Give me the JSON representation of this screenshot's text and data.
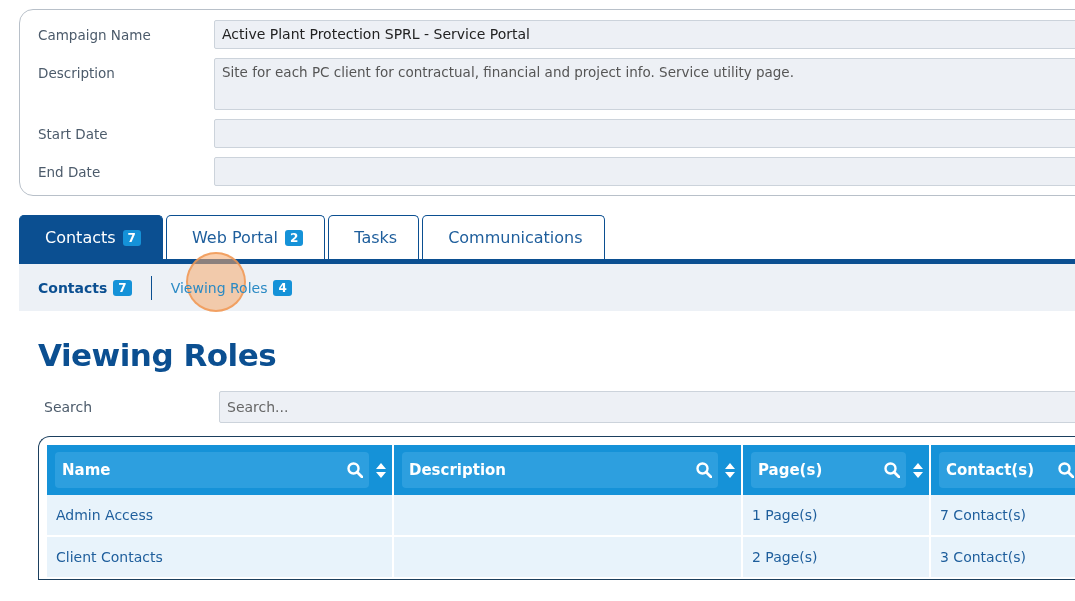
{
  "form": {
    "fields": [
      {
        "label": "Campaign Name",
        "value": "Active Plant Protection SPRL - Service Portal",
        "kind": "text"
      },
      {
        "label": "Description",
        "value": "Site for each PC client for contractual, financial and project info. Service utility page.",
        "kind": "textarea"
      },
      {
        "label": "Start Date",
        "kind": "text"
      },
      {
        "label": "End Date",
        "kind": "text"
      }
    ]
  },
  "tabs": [
    {
      "label": "Contacts",
      "badge": "7",
      "selected": true
    },
    {
      "label": "Web Portal",
      "badge": "2",
      "selected": false
    },
    {
      "label": "Tasks",
      "selected": false
    },
    {
      "label": "Communications",
      "selected": false
    }
  ],
  "subtabs": [
    {
      "label": "Contacts",
      "badge": "7",
      "selected": true,
      "highlighted": false
    },
    {
      "label": "Viewing Roles",
      "badge": "4",
      "selected": false,
      "highlighted": true
    }
  ],
  "heading": "Viewing Roles",
  "search": {
    "label": "Search",
    "placeholder": "Search..."
  },
  "table": {
    "columns": [
      "Name",
      "Description",
      "Page(s)",
      "Contact(s)"
    ],
    "rows": [
      [
        "Admin Access",
        "",
        "1 Page(s)",
        "7 Contact(s)"
      ],
      [
        "Client Contacts",
        "",
        "2 Page(s)",
        "3 Contact(s)"
      ]
    ]
  }
}
